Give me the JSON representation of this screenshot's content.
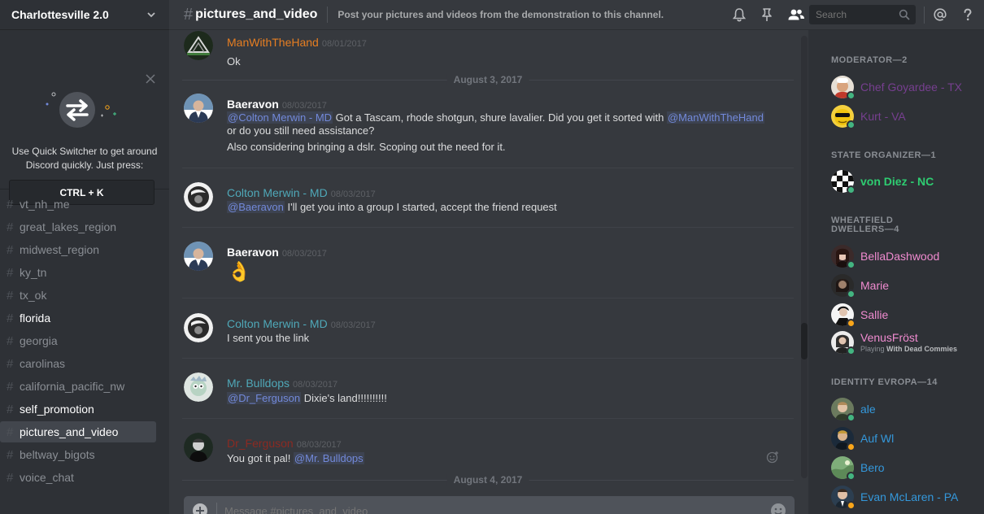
{
  "server": {
    "name": "Charlottesville 2.0"
  },
  "quick_switcher": {
    "text": "Use Quick Switcher to get around Discord quickly. Just press:",
    "shortcut": "CTRL + K"
  },
  "channels": [
    {
      "name": "vt_nh_me",
      "state": "normal"
    },
    {
      "name": "great_lakes_region",
      "state": "normal"
    },
    {
      "name": "midwest_region",
      "state": "normal"
    },
    {
      "name": "ky_tn",
      "state": "normal"
    },
    {
      "name": "tx_ok",
      "state": "normal"
    },
    {
      "name": "florida",
      "state": "unread"
    },
    {
      "name": "georgia",
      "state": "normal"
    },
    {
      "name": "carolinas",
      "state": "normal"
    },
    {
      "name": "california_pacific_nw",
      "state": "normal"
    },
    {
      "name": "self_promotion",
      "state": "unread"
    },
    {
      "name": "pictures_and_video",
      "state": "active"
    },
    {
      "name": "beltway_bigots",
      "state": "normal"
    },
    {
      "name": "voice_chat",
      "state": "normal"
    }
  ],
  "header": {
    "hash": "#",
    "channel": "pictures_and_video",
    "topic": "Post your pictures and videos from the demonstration to this channel.",
    "search_placeholder": "Search"
  },
  "messages": {
    "m1": {
      "author": "ManWithTheHand",
      "timestamp": "08/01/2017",
      "color": "#e67e22",
      "text": "Ok"
    },
    "d1": "August 3, 2017",
    "m2": {
      "author": "Baeravon",
      "timestamp": "08/03/2017",
      "color": "#ffffff",
      "mention_a": "@Colton Merwin - MD",
      "text_a": " Got a Tascam, rhode shotgun, shure lavalier. Did you get it sorted with ",
      "mention_b": "@ManWithTheHand",
      "text_b": "or do you still need assistance?",
      "text_c": "Also considering bringing a dslr. Scoping out the need for it."
    },
    "m3": {
      "author": "Colton Merwin - MD",
      "timestamp": "08/03/2017",
      "color": "#4fa8b8",
      "mention": "@Baeravon",
      "text": " I'll get you into a group I started, accept the friend request"
    },
    "m4": {
      "author": "Baeravon",
      "timestamp": "08/03/2017",
      "color": "#ffffff",
      "emoji": "👌"
    },
    "m5": {
      "author": "Colton Merwin - MD",
      "timestamp": "08/03/2017",
      "color": "#4fa8b8",
      "text": "I sent you the link"
    },
    "m6": {
      "author": "Mr. Bulldops",
      "timestamp": "08/03/2017",
      "color": "#4fa8b8",
      "mention": "@Dr_Ferguson",
      "text": " Dixie's land!!!!!!!!!!"
    },
    "m7": {
      "author": "Dr_Ferguson",
      "timestamp": "08/03/2017",
      "color": "#8b2a22",
      "text": "You got it pal! ",
      "mention": "@Mr. Bulldops"
    },
    "d2": "August 4, 2017"
  },
  "composer": {
    "placeholder": "Message #pictures_and_video"
  },
  "members": {
    "moderator": {
      "heading": "MODERATOR—2",
      "list": [
        {
          "name": "Chef Goyardee - TX",
          "color": "#8e44ad",
          "status": "online"
        },
        {
          "name": "Kurt - VA",
          "color": "#8e44ad",
          "status": "online"
        }
      ]
    },
    "state_organizer": {
      "heading": "STATE ORGANIZER—1",
      "list": [
        {
          "name": "von Diez - NC",
          "color": "#2ecc71",
          "status": "online"
        }
      ]
    },
    "wheatfield": {
      "heading": "WHEATFIELD DWELLERS—4",
      "list": [
        {
          "name": "BellaDashwood",
          "color": "#f08bd0",
          "status": "online"
        },
        {
          "name": "Marie",
          "color": "#f08bd0",
          "status": "online"
        },
        {
          "name": "Sallie",
          "color": "#f08bd0",
          "status": "idle"
        },
        {
          "name": "VenusFröst",
          "color": "#f08bd0",
          "status": "online",
          "activity_prefix": "Playing ",
          "activity_game": "With Dead Commies"
        }
      ]
    },
    "identity_evropa": {
      "heading": "IDENTITY EVROPA—14",
      "list": [
        {
          "name": "ale",
          "color": "#3498db",
          "status": "online"
        },
        {
          "name": "Auf Wl",
          "color": "#3498db",
          "status": "idle"
        },
        {
          "name": "Bero",
          "color": "#3498db",
          "status": "online"
        },
        {
          "name": "Evan McLaren - PA",
          "color": "#3498db",
          "status": "idle"
        }
      ]
    }
  },
  "colors": {
    "online": "#43b581",
    "idle": "#faa61a",
    "mention": "#7289da",
    "accent": "#7289da"
  }
}
